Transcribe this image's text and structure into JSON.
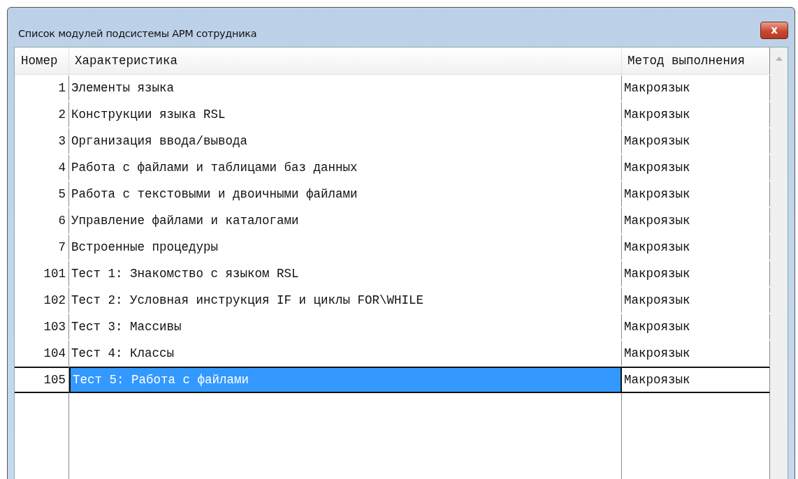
{
  "window": {
    "title": "Список модулей подсистемы АРМ сотрудника",
    "close": "x"
  },
  "table": {
    "columns": [
      "Номер",
      "Характеристика",
      "Метод выполнения"
    ],
    "rows": [
      {
        "number": "1",
        "name": "Элементы языка",
        "method": "Макроязык",
        "selected": false
      },
      {
        "number": "2",
        "name": "Конструкции языка RSL",
        "method": "Макроязык",
        "selected": false
      },
      {
        "number": "3",
        "name": "Организация ввода/вывода",
        "method": "Макроязык",
        "selected": false
      },
      {
        "number": "4",
        "name": "Работа с файлами и таблицами баз данных",
        "method": "Макроязык",
        "selected": false
      },
      {
        "number": "5",
        "name": "Работа с текстовыми и двоичными файлами",
        "method": "Макроязык",
        "selected": false
      },
      {
        "number": "6",
        "name": "Управление файлами и каталогами",
        "method": "Макроязык",
        "selected": false
      },
      {
        "number": "7",
        "name": "Встроенные процедуры",
        "method": "Макроязык",
        "selected": false
      },
      {
        "number": "101",
        "name": "Тест 1: Знакомство с языком RSL",
        "method": "Макроязык",
        "selected": false
      },
      {
        "number": "102",
        "name": "Тест 2: Условная инструкция IF и циклы FOR\\WHILE",
        "method": "Макроязык",
        "selected": false
      },
      {
        "number": "103",
        "name": "Тест 3: Массивы",
        "method": "Макроязык",
        "selected": false
      },
      {
        "number": "104",
        "name": "Тест 4: Классы",
        "method": "Макроязык",
        "selected": false
      },
      {
        "number": "105",
        "name": "Тест 5: Работа с файлами",
        "method": "Макроязык",
        "selected": true
      }
    ]
  }
}
